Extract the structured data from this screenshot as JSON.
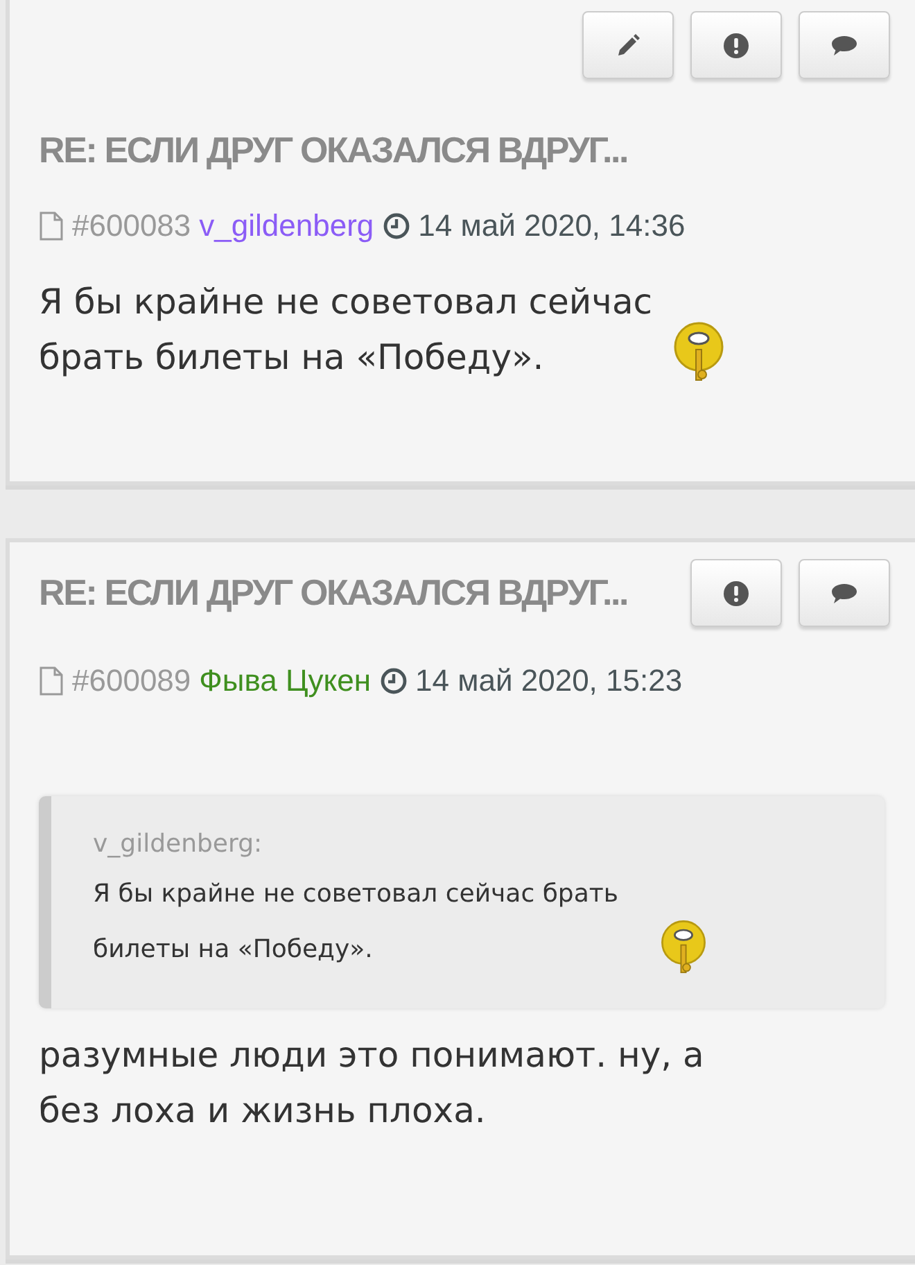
{
  "posts": [
    {
      "buttons": [
        {
          "kind": "edit"
        },
        {
          "kind": "report"
        },
        {
          "kind": "reply"
        }
      ],
      "title": "RE: ЕСЛИ ДРУГ ОКАЗАЛСЯ ВДРУГ...",
      "number": "#600083",
      "author": "v_gildenberg",
      "color": "#8b5cf6",
      "date": "14 май 2020, 14:36",
      "body": "Я бы крайне не советовал сейчас брать билеты на «Победу».",
      "smiley": true
    },
    {
      "buttons": [
        {
          "kind": "report"
        },
        {
          "kind": "reply"
        }
      ],
      "title": "RE: ЕСЛИ ДРУГ ОКАЗАЛСЯ ВДРУГ...",
      "number": "#600089",
      "author": "Фыва Цукен",
      "color": "#3f8f1f",
      "date": "14 май 2020, 15:23",
      "quote": {
        "author": "v_gildenberg:",
        "text": "Я бы крайне не советовал сейчас брать билеты на «Победу».",
        "smiley": true
      },
      "body": "разумные люди это понимают. ну, а без лоха и жизнь плоха.",
      "smiley": false
    }
  ]
}
